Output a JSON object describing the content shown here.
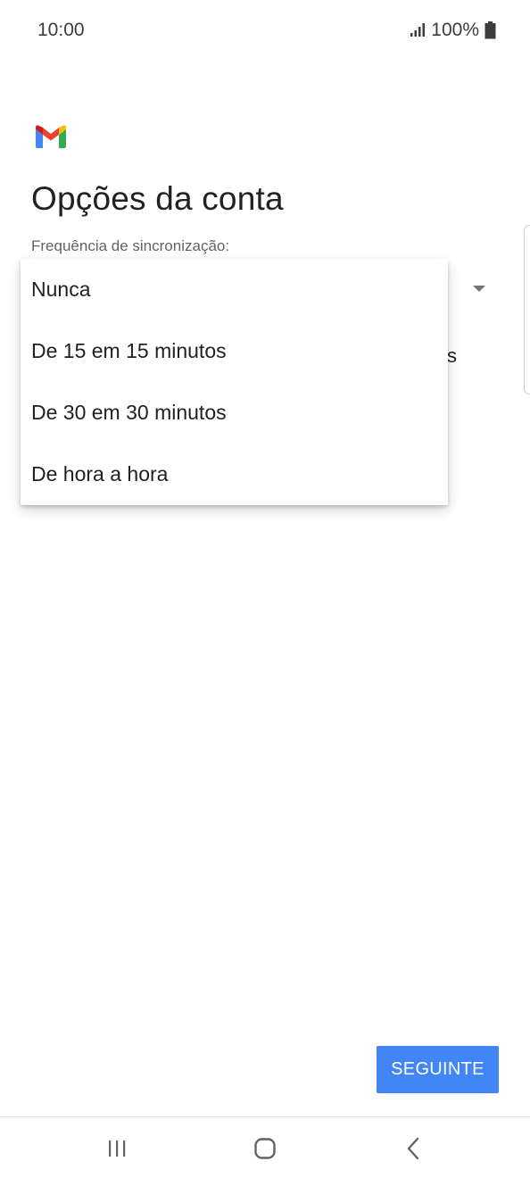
{
  "status_bar": {
    "time": "10:00",
    "battery": "100%",
    "icons": [
      "signal-icon",
      "battery-icon"
    ]
  },
  "app": {
    "logo": "gmail-logo-icon",
    "colors": {
      "red": "#EA4335",
      "blue": "#4285F4",
      "green": "#34A853",
      "yellow": "#FBBC04",
      "button": "#4285F4"
    }
  },
  "page": {
    "title": "Opções da conta",
    "sync_label": "Frequência de sincronização:",
    "partial_text": "s"
  },
  "dropdown": {
    "options": [
      "Nunca",
      "De 15 em 15 minutos",
      "De 30 em 30 minutos",
      "De hora a hora"
    ]
  },
  "actions": {
    "next_label": "SEGUINTE"
  },
  "nav_bar": {
    "icons": [
      "recents-icon",
      "home-icon",
      "back-icon"
    ]
  }
}
